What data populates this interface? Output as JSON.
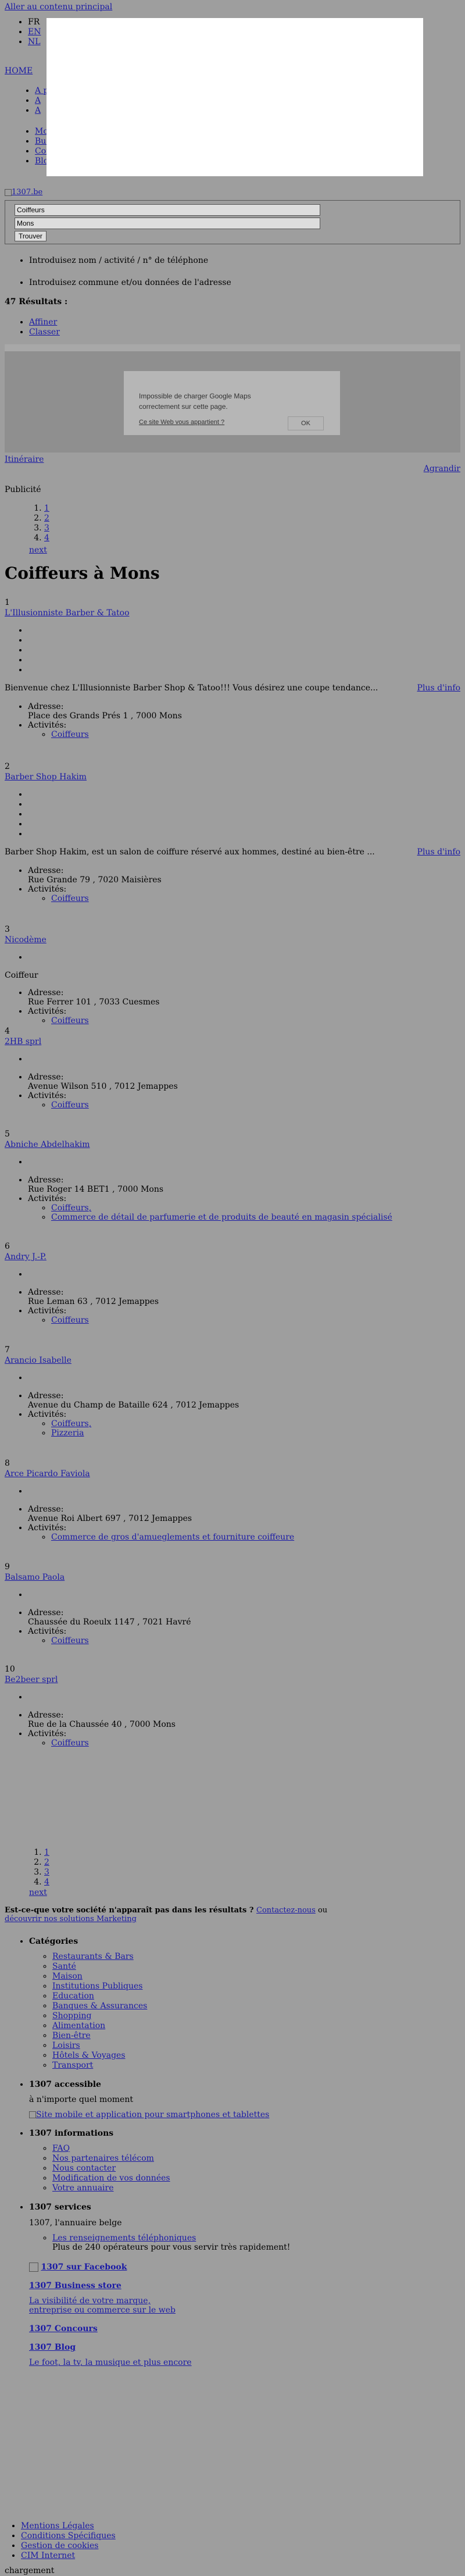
{
  "skip_link": "Aller au contenu principal",
  "languages": [
    "FR",
    "EN",
    "NL"
  ],
  "home_link": "HOME",
  "nav_top": [
    "A pr",
    "A",
    "A"
  ],
  "nav_main": [
    "Mob",
    "Busi",
    "Con",
    "Blog"
  ],
  "logo_alt": "1307.be",
  "search": {
    "what_value": "Coiffeurs",
    "where_value": "Mons",
    "button": "Trouver"
  },
  "hints": [
    "Introduisez nom / activité / n° de téléphone",
    "Introduisez commune et/ou données de l'adresse"
  ],
  "results_count": "47 Résultats :",
  "sort_options": [
    "Affiner",
    "Classer"
  ],
  "map": {
    "message": "Impossible de charger Google Maps correctement sur cette page.",
    "why_link": "Ce site Web vous appartient ?",
    "ok": "OK",
    "itinerary": "Itinéraire",
    "enlarge": "Agrandir"
  },
  "ad_label": "Publicité",
  "pager": [
    "1",
    "2",
    "3",
    "4"
  ],
  "next_label": "next",
  "page_title": "Coiffeurs à Mons",
  "labels": {
    "address": "Adresse:",
    "activities": "Activités:",
    "more": "Plus d'info"
  },
  "listings": [
    {
      "num": "1",
      "name": "L'Illusionniste Barber & Tatoo",
      "desc": "Bienvenue chez L'Illusionniste Barber Shop & Tatoo!!! Vous désirez une coupe tendance...",
      "address": "Place des Grands Prés 1 , 7000 Mons",
      "activities": [
        "Coiffeurs"
      ]
    },
    {
      "num": "2",
      "name": "Barber Shop Hakim",
      "desc": "Barber Shop Hakim, est un salon de coiffure réservé aux hommes, destiné au bien-être ...",
      "address": "Rue Grande 79 , 7020 Maisières",
      "activities": [
        "Coiffeurs"
      ]
    },
    {
      "num": "3",
      "name": "Nicodème",
      "tagline": "Coiffeur",
      "address": "Rue Ferrer 101 , 7033 Cuesmes",
      "activities": [
        "Coiffeurs"
      ]
    },
    {
      "num": "4",
      "name": "2HB sprl",
      "address": "Avenue Wilson 510 , 7012 Jemappes",
      "activities": [
        "Coiffeurs"
      ]
    },
    {
      "num": "5",
      "name": "Abniche Abdelhakim",
      "address": "Rue Roger 14 BET1 , 7000 Mons",
      "activities": [
        "Coiffeurs,",
        "Commerce de détail de parfumerie et de produits de beauté en magasin spécialisé"
      ]
    },
    {
      "num": "6",
      "name": "Andry J.-P.",
      "address": "Rue Leman 63 , 7012 Jemappes",
      "activities": [
        "Coiffeurs"
      ]
    },
    {
      "num": "7",
      "name": "Arancio Isabelle",
      "address": "Avenue du Champ de Bataille 624 , 7012 Jemappes",
      "activities": [
        "Coiffeurs,",
        "Pizzeria"
      ]
    },
    {
      "num": "8",
      "name": "Arce Picardo Faviola",
      "address": "Avenue Roi Albert 697 , 7012 Jemappes",
      "activities": [
        "Commerce de gros d'amueglements et fourniture coiffeure"
      ]
    },
    {
      "num": "9",
      "name": "Balsamo Paola",
      "address": "Chaussée du Roeulx 1147 , 7021 Havré",
      "activities": [
        "Coiffeurs"
      ]
    },
    {
      "num": "10",
      "name": "Be2beer sprl",
      "address": "Rue de la Chaussée 40 , 7000 Mons",
      "activities": [
        "Coiffeurs"
      ]
    }
  ],
  "missing": {
    "text": "Est-ce-que votre société n'apparaît pas dans les résultats ?",
    "contact": "Contactez-nous",
    "or": " ou ",
    "discover": "découvrir nos solutions Marketing"
  },
  "footer": {
    "categories_title": "Catégories",
    "categories": [
      "Restaurants & Bars",
      "Santé",
      "Maison",
      "Institutions Publiques",
      "Education",
      "Banques & Assurances",
      "Shopping",
      "Alimentation",
      "Bien-être",
      "Loisirs",
      "Hôtels & Voyages",
      "Transport"
    ],
    "accessible_title": "1307 accessible",
    "accessible_text": "à n'importe quel moment",
    "accessible_img": "Site mobile et application pour smartphones et tablettes",
    "info_title": "1307 informations",
    "info_links": [
      "FAQ",
      "Nos partenaires télécom",
      "Nous contacter",
      "Modification de vos données",
      "Votre annuaire"
    ],
    "services_title": "1307 services",
    "services_text": "1307, l'annuaire belge",
    "services_link": "Les renseignements téléphoniques",
    "services_sub": "Plus de 240 opérateurs pour vous servir très rapidement!",
    "facebook": "1307 sur Facebook",
    "business_title": "1307 Business store",
    "business_text": "La visibilité de votre marque, entreprise ou commerce sur le web",
    "concours_title": "1307 Concours",
    "blog_title": "1307 Blog",
    "blog_text": "Le foot, la tv, la musique et plus encore"
  },
  "bottom_links": [
    "Mentions Légales",
    "Conditions Spécifiques",
    "Gestion de cookies",
    "CIM Internet"
  ],
  "loading": "chargement"
}
